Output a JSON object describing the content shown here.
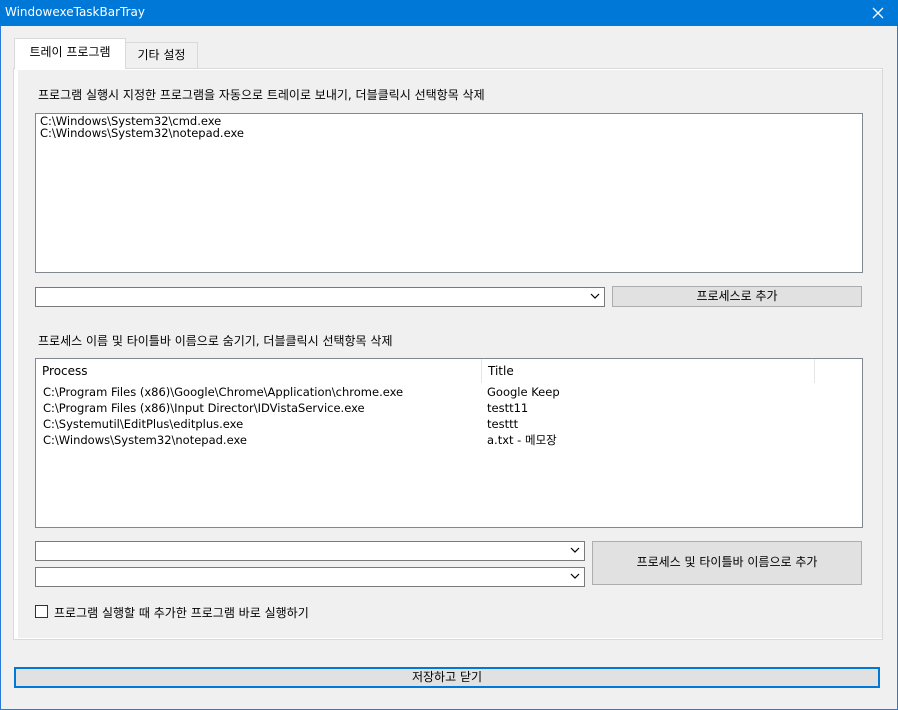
{
  "window": {
    "title": "WindowexeTaskBarTray",
    "close_icon": "close-icon"
  },
  "tabs": [
    {
      "label": "트레이 프로그램",
      "active": true
    },
    {
      "label": "기타 설정",
      "active": false
    }
  ],
  "section1": {
    "description": "프로그램 실행시 지정한 프로그램을 자동으로 트레이로 보내기, 더블클릭시 선택항목 삭제",
    "items": [
      "C:\\Windows\\System32\\cmd.exe",
      "C:\\Windows\\System32\\notepad.exe"
    ],
    "combo_value": "",
    "add_button": "프로세스로 추가"
  },
  "section2": {
    "description": "프로세스 이름 및 타이틀바 이름으로 숨기기, 더블클릭시 선택항목 삭제",
    "columns": [
      "Process",
      "Title"
    ],
    "rows": [
      {
        "process": "C:\\Program Files (x86)\\Google\\Chrome\\Application\\chrome.exe",
        "title": "Google Keep"
      },
      {
        "process": "C:\\Program Files (x86)\\Input Director\\IDVistaService.exe",
        "title": "testt11"
      },
      {
        "process": "C:\\Systemutil\\EditPlus\\editplus.exe",
        "title": "testtt"
      },
      {
        "process": "C:\\Windows\\System32\\notepad.exe",
        "title": "a.txt - 메모장"
      }
    ],
    "combo_process_value": "",
    "combo_title_value": "",
    "add_button": "프로세스 및 타이틀바 이름으로 추가"
  },
  "option": {
    "checkbox_label": "프로그램 실행할 때 추가한 프로그램 바로 실행하기",
    "checked": false
  },
  "footer": {
    "save_button": "저장하고 닫기"
  },
  "colors": {
    "titlebar": "#0078d7",
    "accent_border": "#0078d7"
  }
}
